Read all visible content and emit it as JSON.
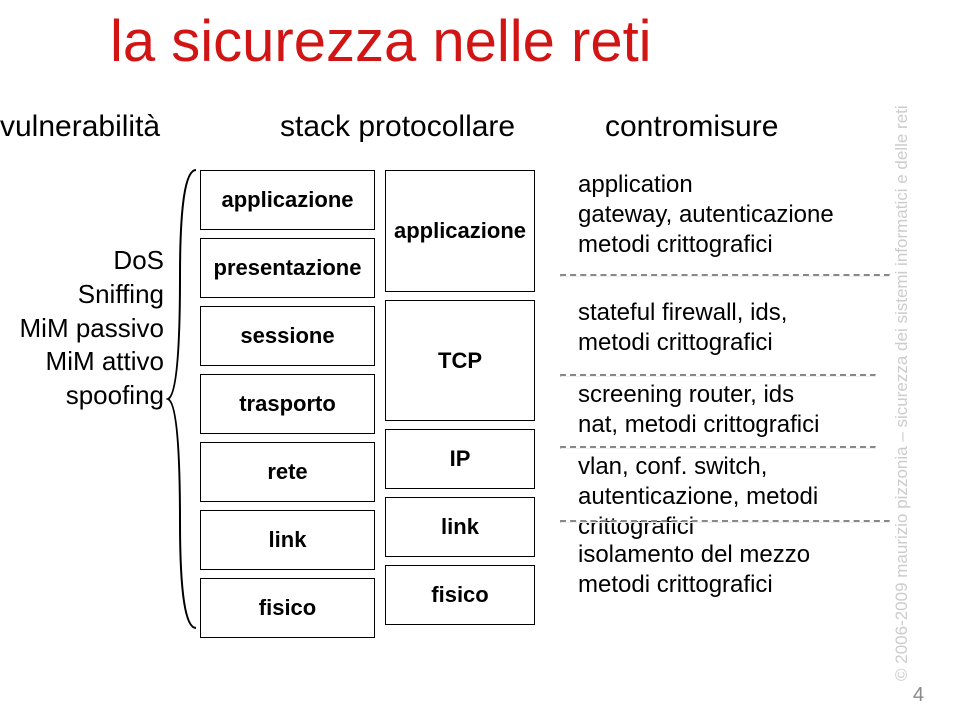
{
  "title": "la sicurezza nelle reti",
  "headers": {
    "vulnerabilita": "vulnerabilità",
    "stack": "stack protocollare",
    "contromisure": "contromisure"
  },
  "vulnerabilities": [
    "DoS",
    "Sniffing",
    "MiM passivo",
    "MiM attivo",
    "spoofing"
  ],
  "osi7": [
    "applicazione",
    "presentazione",
    "sessione",
    "trasporto",
    "rete",
    "link",
    "fisico"
  ],
  "tcpip": [
    "applicazione",
    "TCP",
    "IP",
    "link",
    "fisico"
  ],
  "countermeasures": {
    "application": {
      "l1": "application",
      "l2": "gateway, autenticazione",
      "l3": "metodi crittografici"
    },
    "transport": {
      "l1": "stateful firewall, ids,",
      "l2": "metodi crittografici"
    },
    "network": {
      "l1": "screening router, ids",
      "l2": "nat, metodi crittografici"
    },
    "link": {
      "l1": "vlan, conf. switch,",
      "l2": "autenticazione, metodi crittografici"
    },
    "physical": {
      "l1": "isolamento del mezzo",
      "l2": "metodi crittografici"
    }
  },
  "sidebar": "© 2006-2009 maurizio pizzonia – sicurezza dei sistemi informatici e delle reti",
  "page_number": "4"
}
